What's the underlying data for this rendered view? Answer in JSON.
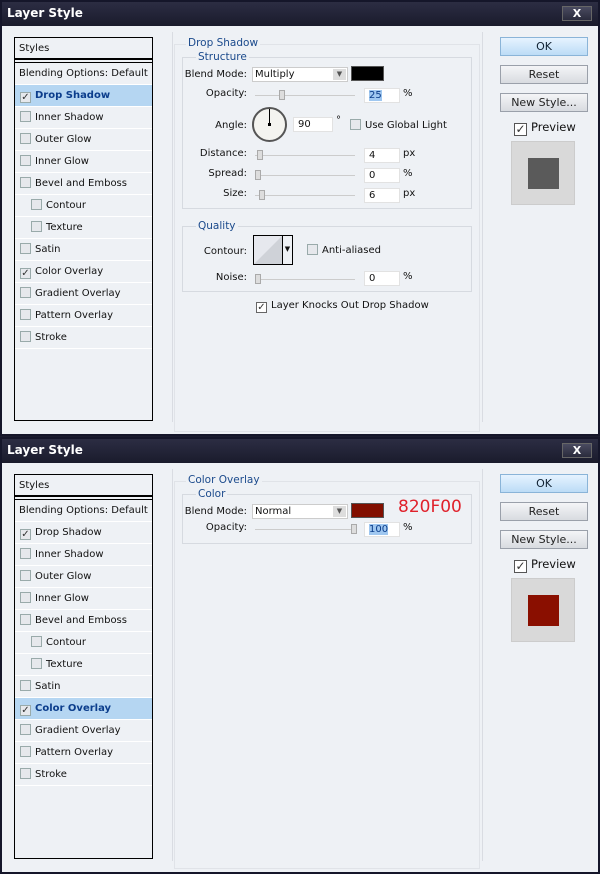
{
  "dialogs": [
    {
      "title": "Layer Style",
      "close_label": "X",
      "styles_header": "Styles",
      "blending_options": "Blending Options: Default",
      "style_items": [
        {
          "label": "Drop Shadow",
          "checked": true,
          "selected": true,
          "sub": false
        },
        {
          "label": "Inner Shadow",
          "checked": false,
          "selected": false,
          "sub": false
        },
        {
          "label": "Outer Glow",
          "checked": false,
          "selected": false,
          "sub": false
        },
        {
          "label": "Inner Glow",
          "checked": false,
          "selected": false,
          "sub": false
        },
        {
          "label": "Bevel and Emboss",
          "checked": false,
          "selected": false,
          "sub": false
        },
        {
          "label": "Contour",
          "checked": false,
          "selected": false,
          "sub": true
        },
        {
          "label": "Texture",
          "checked": false,
          "selected": false,
          "sub": true
        },
        {
          "label": "Satin",
          "checked": false,
          "selected": false,
          "sub": false
        },
        {
          "label": "Color Overlay",
          "checked": true,
          "selected": false,
          "sub": false
        },
        {
          "label": "Gradient Overlay",
          "checked": false,
          "selected": false,
          "sub": false
        },
        {
          "label": "Pattern Overlay",
          "checked": false,
          "selected": false,
          "sub": false
        },
        {
          "label": "Stroke",
          "checked": false,
          "selected": false,
          "sub": false
        }
      ],
      "panel": {
        "section_title": "Drop Shadow",
        "structure_title": "Structure",
        "blend_mode_label": "Blend Mode:",
        "blend_mode_value": "Multiply",
        "color": "#000000",
        "opacity_label": "Opacity:",
        "opacity_value": "25",
        "opacity_unit": "%",
        "angle_label": "Angle:",
        "angle_value": "90",
        "angle_unit": "°",
        "use_global_light_label": "Use Global Light",
        "use_global_light_checked": false,
        "distance_label": "Distance:",
        "distance_value": "4",
        "distance_unit": "px",
        "spread_label": "Spread:",
        "spread_value": "0",
        "spread_unit": "%",
        "size_label": "Size:",
        "size_value": "6",
        "size_unit": "px",
        "quality_title": "Quality",
        "contour_label": "Contour:",
        "anti_aliased_label": "Anti-aliased",
        "anti_aliased_checked": false,
        "noise_label": "Noise:",
        "noise_value": "0",
        "noise_unit": "%",
        "knockout_label": "Layer Knocks Out Drop Shadow",
        "knockout_checked": true
      },
      "buttons": {
        "ok": "OK",
        "reset": "Reset",
        "new_style": "New Style..."
      },
      "preview_label": "Preview",
      "preview_checked": true,
      "preview_color": "#5a5a5a"
    },
    {
      "title": "Layer Style",
      "close_label": "X",
      "styles_header": "Styles",
      "blending_options": "Blending Options: Default",
      "style_items": [
        {
          "label": "Drop Shadow",
          "checked": true,
          "selected": false,
          "sub": false
        },
        {
          "label": "Inner Shadow",
          "checked": false,
          "selected": false,
          "sub": false
        },
        {
          "label": "Outer Glow",
          "checked": false,
          "selected": false,
          "sub": false
        },
        {
          "label": "Inner Glow",
          "checked": false,
          "selected": false,
          "sub": false
        },
        {
          "label": "Bevel and Emboss",
          "checked": false,
          "selected": false,
          "sub": false
        },
        {
          "label": "Contour",
          "checked": false,
          "selected": false,
          "sub": true
        },
        {
          "label": "Texture",
          "checked": false,
          "selected": false,
          "sub": true
        },
        {
          "label": "Satin",
          "checked": false,
          "selected": false,
          "sub": false
        },
        {
          "label": "Color Overlay",
          "checked": true,
          "selected": true,
          "sub": false
        },
        {
          "label": "Gradient Overlay",
          "checked": false,
          "selected": false,
          "sub": false
        },
        {
          "label": "Pattern Overlay",
          "checked": false,
          "selected": false,
          "sub": false
        },
        {
          "label": "Stroke",
          "checked": false,
          "selected": false,
          "sub": false
        }
      ],
      "panel": {
        "section_title": "Color Overlay",
        "color_title": "Color",
        "blend_mode_label": "Blend Mode:",
        "blend_mode_value": "Normal",
        "color": "#820F00",
        "color_annotation": "820F00",
        "opacity_label": "Opacity:",
        "opacity_value": "100",
        "opacity_unit": "%"
      },
      "buttons": {
        "ok": "OK",
        "reset": "Reset",
        "new_style": "New Style..."
      },
      "preview_label": "Preview",
      "preview_checked": true,
      "preview_color": "#8a0f00"
    }
  ]
}
